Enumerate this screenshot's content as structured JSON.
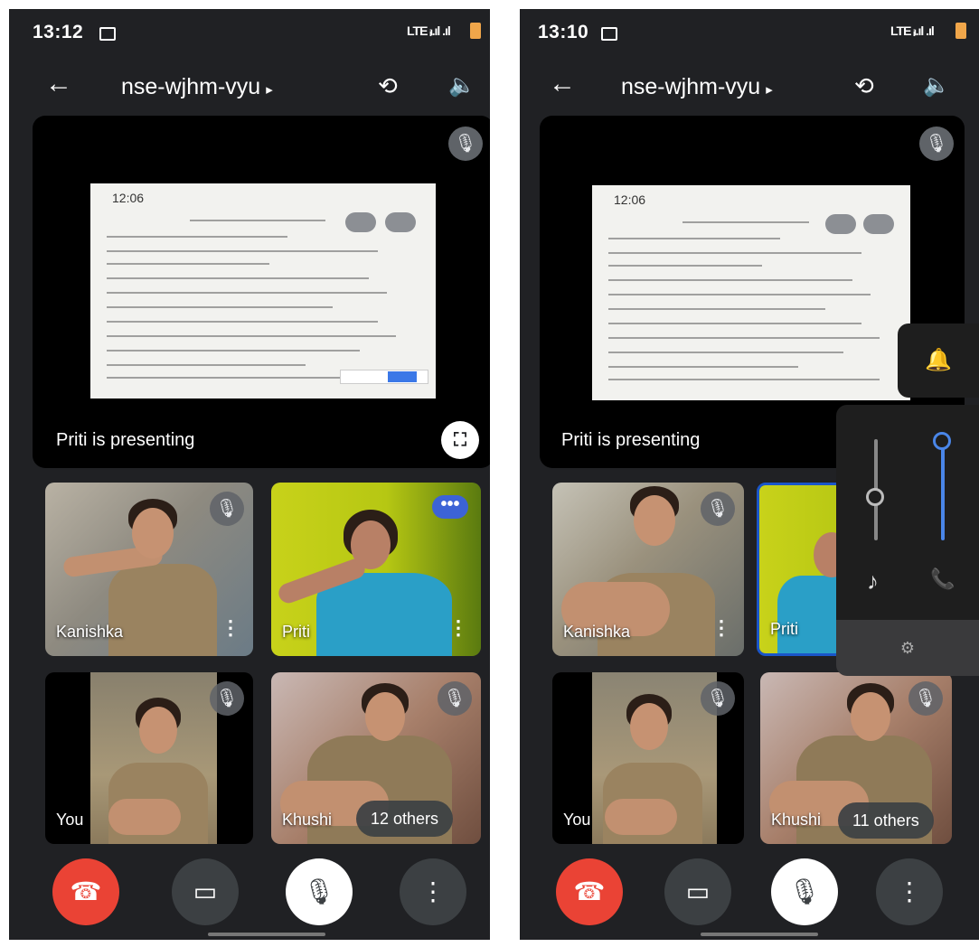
{
  "left": {
    "status_time": "13:12",
    "signal": "LTE ᵢₗ.ıl .ıl",
    "meeting_code": "nse-wjhm-vyu",
    "presentation_label": "Priti is presenting",
    "screen_time": "12:06",
    "tiles": [
      {
        "name": "Kanishka"
      },
      {
        "name": "Priti"
      },
      {
        "name": "You"
      },
      {
        "name": "Khushi"
      }
    ],
    "others_count": "12 others"
  },
  "right": {
    "status_time": "13:10",
    "signal": "LTE ᵢₗ.ıl .ıl",
    "meeting_code": "nse-wjhm-vyu",
    "presentation_label": "Priti is presenting",
    "screen_time": "12:06",
    "tiles": [
      {
        "name": "Kanishka"
      },
      {
        "name": "Priti"
      },
      {
        "name": "You"
      },
      {
        "name": "Khushi"
      }
    ],
    "others_count": "11 others"
  },
  "icons": {
    "back": "←",
    "arrow": "▸",
    "switch_camera": "⟲",
    "speaker": "🔈",
    "mic_off": "🎙",
    "fullscreen": "⛶",
    "more_vert": "⋮",
    "more_horiz": "•••",
    "end_call": "☎",
    "camera": "▭",
    "bell": "🔔",
    "music": "♪",
    "phone": "📞",
    "settings": "⚙"
  },
  "colors": {
    "background": "#202124",
    "end_call": "#ea4335",
    "accent_blue": "#4a86e8",
    "tile": "#3c4043"
  }
}
